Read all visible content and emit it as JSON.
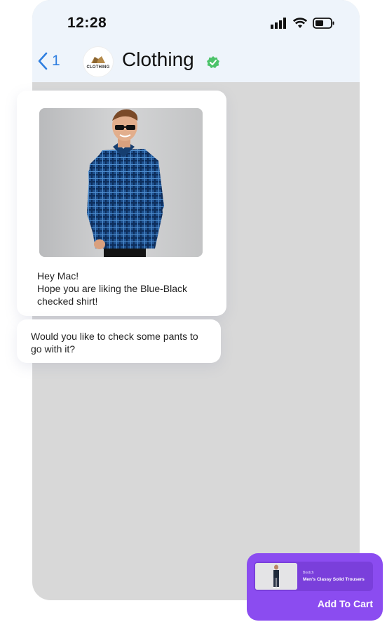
{
  "status_bar": {
    "time": "12:28"
  },
  "header": {
    "back_count": "1",
    "avatar_text": "CLOTHING",
    "title": "Clothing"
  },
  "messages": [
    {
      "text_line1": "Hey Mac!",
      "text_line2": "Hope you are liking the Blue-Black checked shirt!"
    },
    {
      "text": "Would you like to check some pants to go with it?"
    }
  ],
  "product_card": {
    "brand": "Bootch",
    "name": "Men's Classy Solid Trousers",
    "button_label": "Add To Cart"
  },
  "colors": {
    "accent": "#8b4cf0",
    "link": "#2f7fe0",
    "verified": "#4cc36a",
    "shirt": "#1e4f8c"
  }
}
